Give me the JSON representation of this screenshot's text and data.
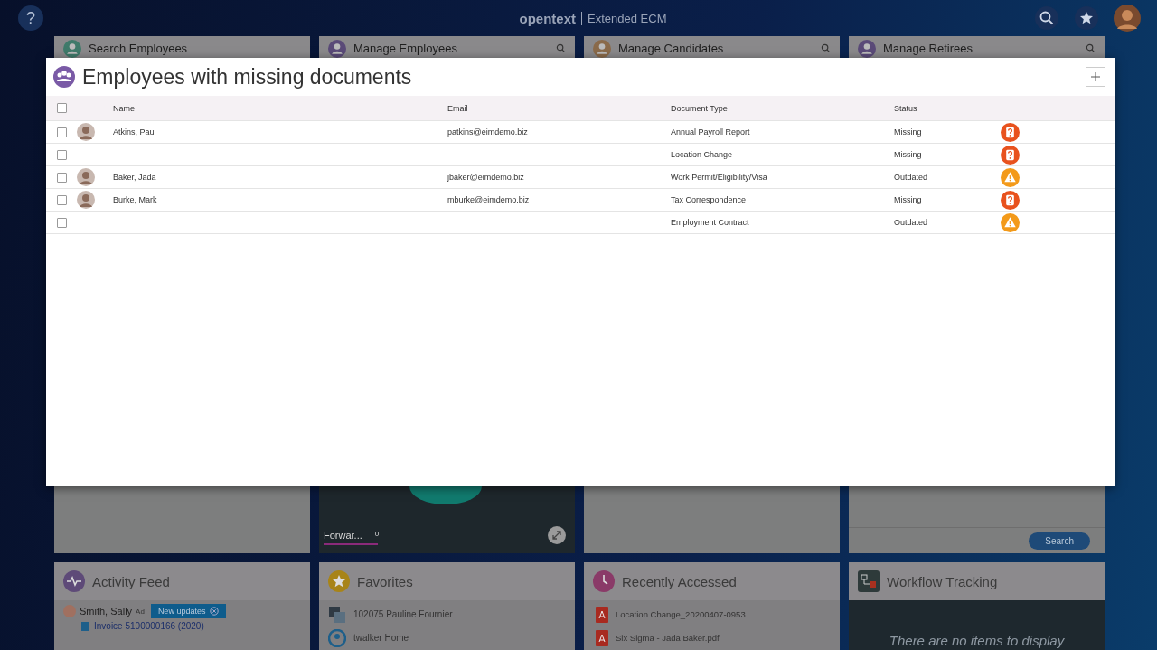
{
  "header": {
    "help": "?",
    "logo": "opentext",
    "product": "Extended ECM"
  },
  "tiles": [
    {
      "title": "Search Employees",
      "search": false
    },
    {
      "title": "Manage Employees",
      "search": true
    },
    {
      "title": "Manage Candidates",
      "search": true
    },
    {
      "title": "Manage Retirees",
      "search": true
    }
  ],
  "forward_widget": {
    "label": "Forwar...",
    "count": "0"
  },
  "retirees_button": "Search",
  "activity_feed": {
    "title": "Activity Feed",
    "user": "Smith, Sally",
    "action": "Ad",
    "badge": "New updates",
    "item": "Invoice 5100000166 (2020)"
  },
  "favorites": {
    "title": "Favorites",
    "items": [
      {
        "label": "102075 Pauline Fournier",
        "kind": "workspace"
      },
      {
        "label": "twalker Home",
        "kind": "home"
      }
    ]
  },
  "recent": {
    "title": "Recently Accessed",
    "items": [
      "Location Change_20200407-0953...",
      "Six Sigma - Jada Baker.pdf"
    ]
  },
  "workflow": {
    "title": "Workflow Tracking",
    "empty": "There are no items to display"
  },
  "modal": {
    "title": "Employees with missing documents",
    "columns": [
      "Name",
      "Email",
      "Document Type",
      "Status"
    ],
    "all_checked": false,
    "rows": [
      {
        "checked": false,
        "name": "Atkins, Paul",
        "email": "patkins@eimdemo.biz",
        "doc": "Annual Payroll Report",
        "status": "Missing",
        "kind": "missing"
      },
      {
        "checked": false,
        "doc": "Location Change",
        "status": "Missing",
        "kind": "missing"
      },
      {
        "checked": false,
        "name": "Baker, Jada",
        "email": "jbaker@eimdemo.biz",
        "doc": "Work Permit/Eligibility/Visa",
        "status": "Outdated",
        "kind": "outdated"
      },
      {
        "checked": false,
        "name": "Burke, Mark",
        "email": "mburke@eimdemo.biz",
        "doc": "Tax Correspondence",
        "status": "Missing",
        "kind": "missing"
      },
      {
        "checked": false,
        "doc": "Employment Contract",
        "status": "Outdated",
        "kind": "outdated"
      }
    ]
  }
}
